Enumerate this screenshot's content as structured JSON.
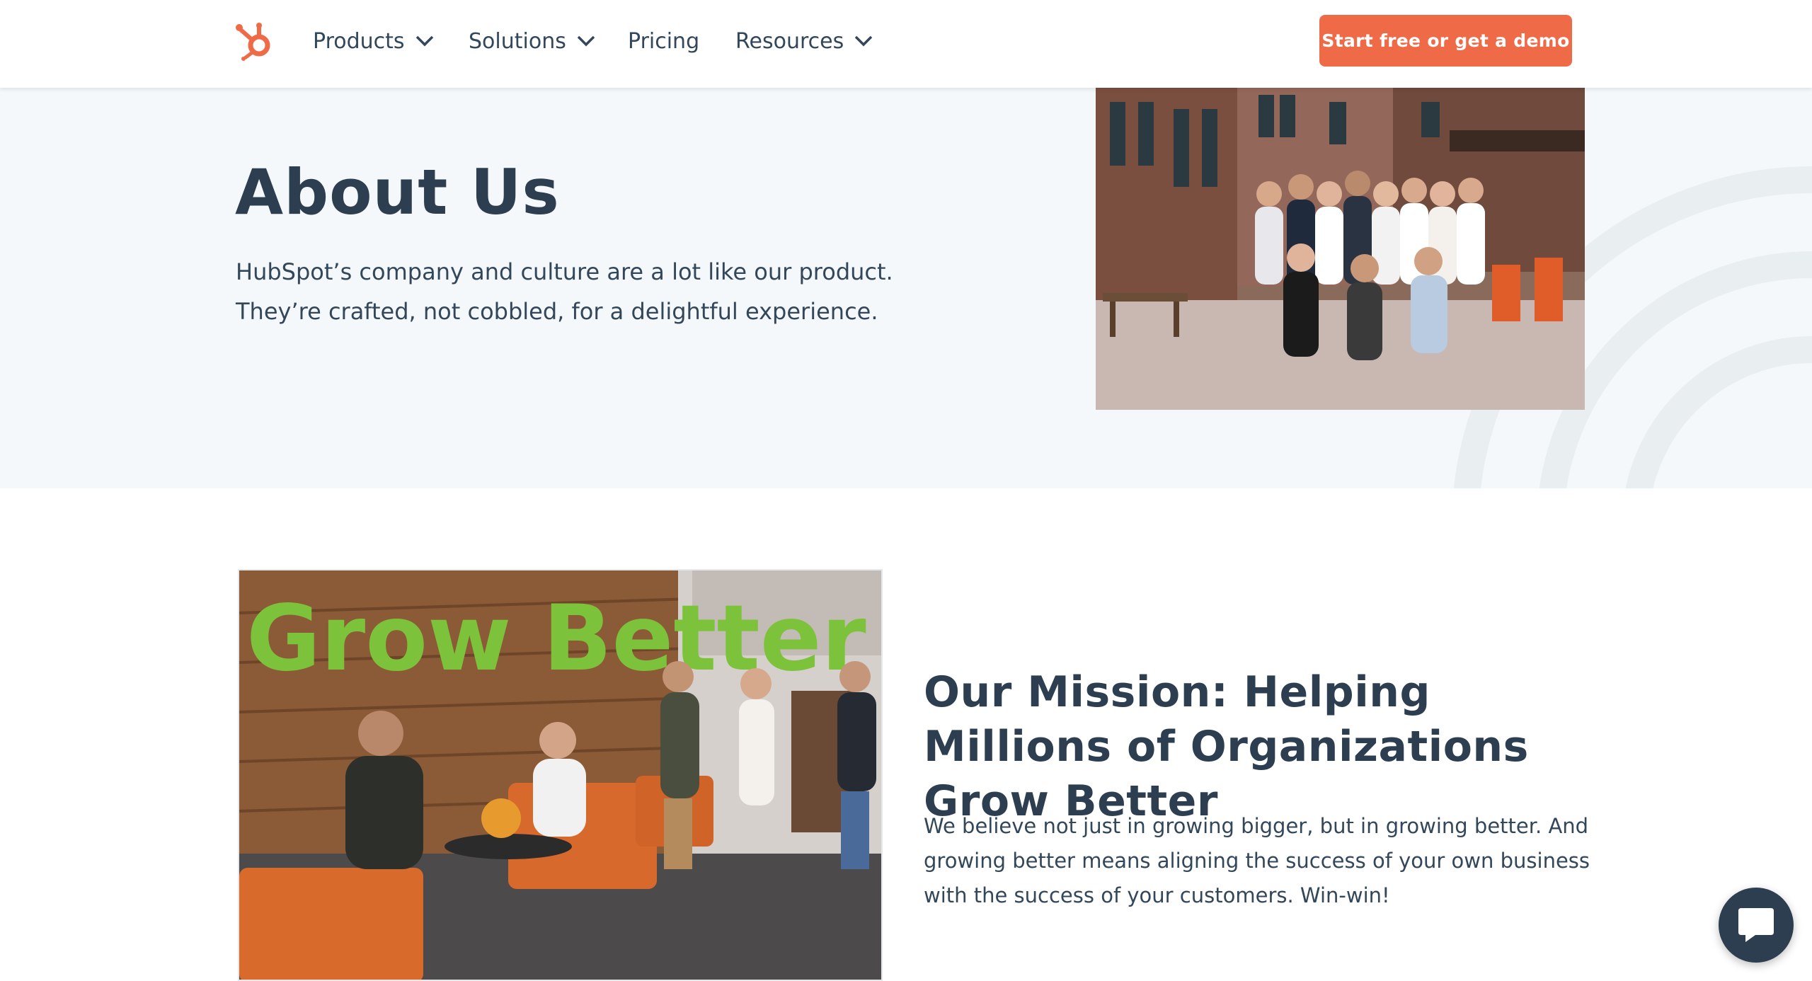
{
  "nav": {
    "items": [
      {
        "label": "Products",
        "has_dropdown": true
      },
      {
        "label": "Solutions",
        "has_dropdown": true
      },
      {
        "label": "Pricing",
        "has_dropdown": false
      },
      {
        "label": "Resources",
        "has_dropdown": true
      }
    ],
    "cta_label": "Start free or get a demo",
    "logo_icon": "hubspot-sprocket-icon"
  },
  "hero": {
    "title": "About Us",
    "text": "HubSpot’s company and culture are a lot like our product. They’re crafted, not cobbled, for a delightful experience."
  },
  "mission": {
    "title": "Our Mission: Helping Millions of Organizations Grow Better",
    "text": "We believe not just in growing bigger, but in growing better. And growing better means aligning the success of your own business with the success of your customers. Win-win!",
    "photo_sign": "Grow Better"
  },
  "chat": {
    "icon": "chat-bubble-icon"
  },
  "colors": {
    "accent": "#ef6b48",
    "heading": "#2d3e50",
    "text": "#33475b",
    "hero_bg": "#f5f8fa",
    "chat_bg": "#2d3e50"
  }
}
